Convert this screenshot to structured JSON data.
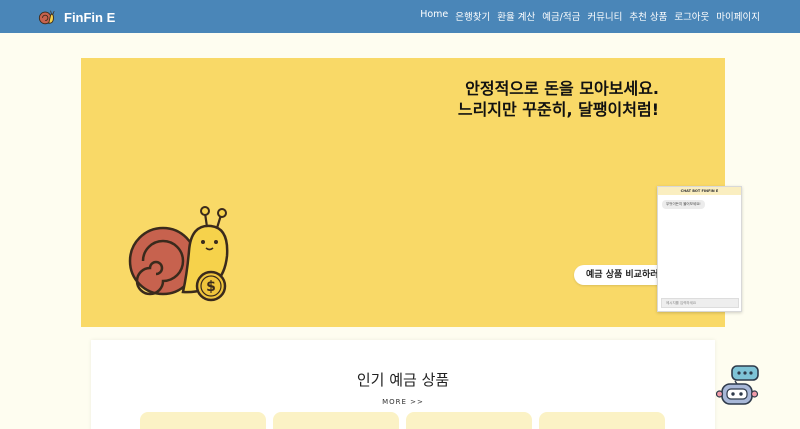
{
  "brand": {
    "name": "FinFin E",
    "logo_icon": "snail-logo-icon"
  },
  "nav": {
    "items": [
      {
        "label": "Home"
      },
      {
        "label": "은행찾기"
      },
      {
        "label": "환율 계산"
      },
      {
        "label": "예금/적금"
      },
      {
        "label": "커뮤니티"
      },
      {
        "label": "추천 상품"
      },
      {
        "label": "로그아웃"
      },
      {
        "label": "마이페이지"
      }
    ]
  },
  "hero": {
    "line1": "안정적으로 돈을 모아보세요.",
    "line2": "느리지만 꾸준히, 달팽이처럼!",
    "cta_label": "예금 상품 비교하러 가기",
    "illustration_icon": "snail-coin-icon",
    "background": "#f9d967"
  },
  "chatbot": {
    "header": "CHAT BOT FINFIN E",
    "bubble": "무엇이든지 물어보세요!",
    "input_placeholder": "메시지를 입력하세요"
  },
  "popular": {
    "title": "인기 예금 상품",
    "more_label": "MORE >>"
  },
  "colors": {
    "navbar": "#4a86b8",
    "page_background": "#fefdf0",
    "card": "#fbf2c5"
  },
  "floating_button": {
    "icon": "robot-chatbot-icon"
  }
}
